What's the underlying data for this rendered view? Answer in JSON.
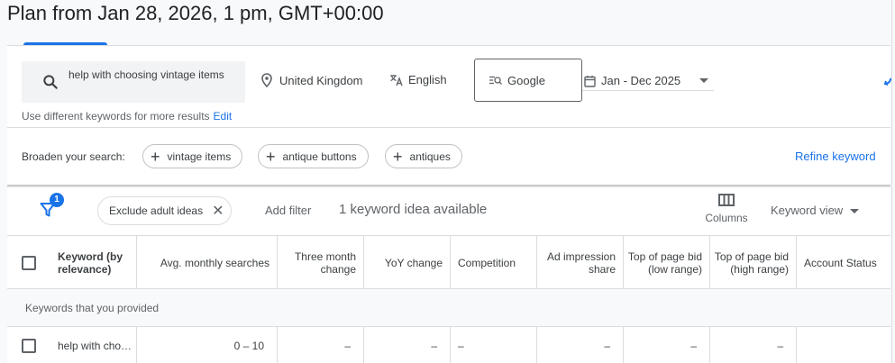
{
  "page": {
    "title": "Plan from Jan 28, 2026, 1 pm, GMT+00:00"
  },
  "search": {
    "keywords": "help with choosing vintage items",
    "location": "United Kingdom",
    "language": "English",
    "network": "Google",
    "date_range": "Jan - Dec 2025",
    "hint": "Use different keywords for more results",
    "edit_label": "Edit"
  },
  "broaden": {
    "label": "Broaden your search:",
    "chips": [
      "vintage items",
      "antique buttons",
      "antiques"
    ],
    "refine_label": "Refine keyword"
  },
  "toolbar": {
    "filter_count": "1",
    "exclude_chip": "Exclude adult ideas",
    "add_filter": "Add filter",
    "available": "1 keyword idea available",
    "columns_label": "Columns",
    "view_label": "Keyword view"
  },
  "table": {
    "headers": {
      "keyword": "Keyword (by relevance)",
      "searches": "Avg. monthly searches",
      "three_month": "Three month change",
      "yoy": "YoY change",
      "competition": "Competition",
      "impression": "Ad impression share",
      "bid_low": "Top of page bid (low range)",
      "bid_high": "Top of page bid (high range)",
      "account": "Account Status"
    },
    "section_label": "Keywords that you provided",
    "rows": [
      {
        "keyword": "help with cho…",
        "searches": "0 – 10",
        "three_month": "–",
        "yoy": "–",
        "competition": "–",
        "impression": "–",
        "bid_low": "–",
        "bid_high": "–",
        "account": ""
      }
    ]
  },
  "colors": {
    "accent": "#1a73e8",
    "text": "#3c4043",
    "muted": "#5f6368",
    "border": "#dadce0"
  }
}
